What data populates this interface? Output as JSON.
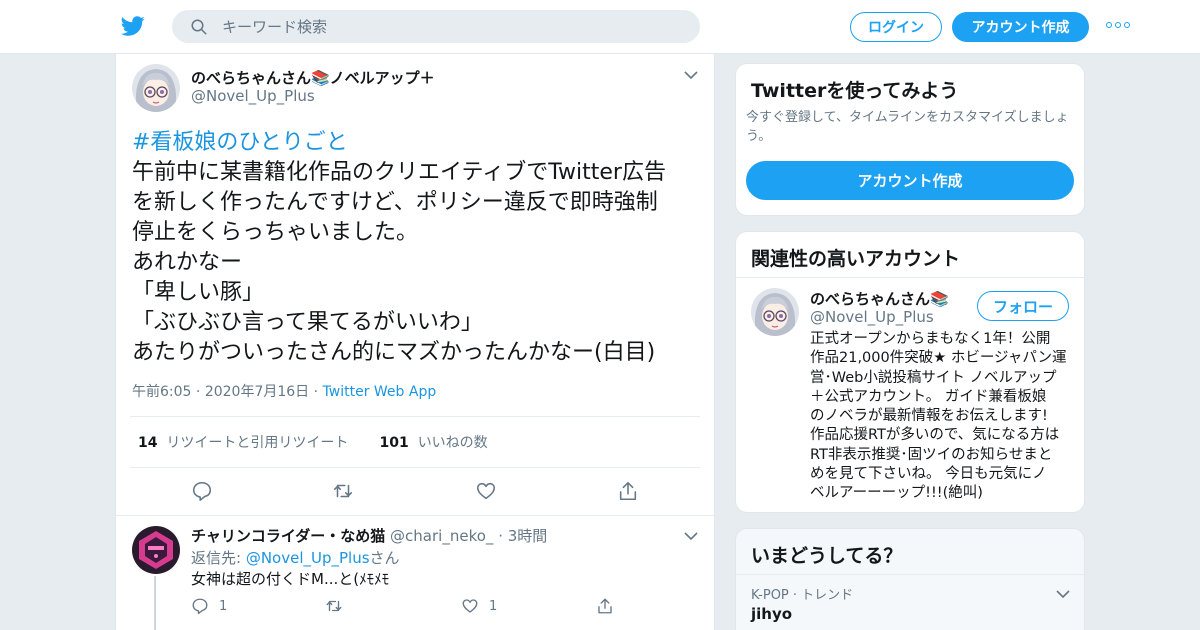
{
  "header": {
    "search_placeholder": "キーワード検索",
    "login_label": "ログイン",
    "signup_label": "アカウント作成"
  },
  "tweet": {
    "display_name": "のべらちゃんさん📚ノベルアップ＋",
    "handle": "@Novel_Up_Plus",
    "hashtag": "#看板娘のひとりごと",
    "lines": [
      "午前中に某書籍化作品のクリエイティブでTwitter広告",
      "を新しく作ったんですけど、ポリシー違反で即時強制",
      "停止をくらっちゃいました。",
      "あれかなー",
      "「卑しい豚」",
      "「ぶひぶひ言って果てるがいいわ」",
      "あたりがついったさん的にマズかったんかなー(白目)"
    ],
    "time": "午前6:05",
    "date": "2020年7月16日",
    "source": "Twitter Web App",
    "retweet_count": "14",
    "retweet_label": "リツイートと引用リツイート",
    "like_count": "101",
    "like_label": "いいねの数"
  },
  "reply": {
    "display_name": "チャリンコライダー・なめ猫",
    "handle": "@chari_neko_",
    "time": "3時間",
    "reply_prefix": "返信先: ",
    "reply_mention": "@Novel_Up_Plus",
    "reply_suffix": "さん",
    "text": "女神は超の付くドM...と(ﾒﾓﾒﾓ",
    "reply_count": "1",
    "like_count": "1"
  },
  "try_card": {
    "title": "Twitterを使ってみよう",
    "subtitle_lines": [
      "今すぐ登録して、タイムラインをカスタマイズしましょ",
      "う。"
    ],
    "button": "アカウント作成"
  },
  "related": {
    "title": "関連性の高いアカウント",
    "display_name": "のべらちゃんさん📚",
    "handle": "@Novel_Up_Plus",
    "follow_label": "フォロー",
    "bio_lines": [
      "正式オープンからまもなく1年！公開",
      "作品21,000件突破★ ホビージャパン運",
      "営･Web小説投稿サイト ノベルアップ",
      "＋公式アカウント。 ガイド兼看板娘",
      "のノベラが最新情報をお伝えします!",
      "作品応援RTが多いので、気になる方は",
      "RT非表示推奨･固ツイのお知らせまと",
      "めを見て下さいね。 今日も元気にノ",
      "ベルアーーーップ!!!(絶叫)"
    ]
  },
  "trends": {
    "title": "いまどうしてる？",
    "meta": "K-POP · トレンド",
    "name": "jihyo"
  },
  "colors": {
    "accent": "#1da1f2",
    "link": "#1b95e0",
    "muted": "#657786",
    "background": "#e6ecf0"
  },
  "icons": [
    "twitter-bird-icon",
    "search-icon",
    "more-icon",
    "chevron-down-icon",
    "reply-icon",
    "retweet-icon",
    "like-icon",
    "share-icon"
  ]
}
